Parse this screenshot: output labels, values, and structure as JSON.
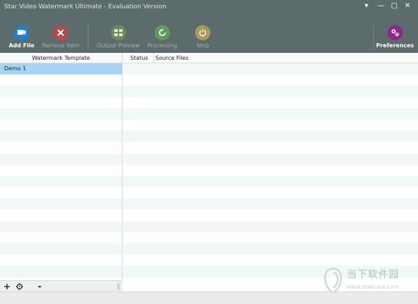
{
  "window": {
    "title": "Star Video Watermark Ultimate - Evaluation Version",
    "controls": [
      "▾",
      "—",
      "▢",
      "✕"
    ]
  },
  "toolbar": {
    "add_file": "Add File",
    "remove_item": "Remove Item",
    "output_preview": "Output Preview",
    "processing": "Processing",
    "stop": "Stop",
    "preferences": "Preferences"
  },
  "left_panel": {
    "header": "Watermark Template",
    "items": [
      "Demo 1"
    ]
  },
  "right_panel": {
    "columns": [
      "Status",
      "Source Files"
    ]
  },
  "watermark": {
    "text": "当下软件园",
    "url": "www.downxia.com"
  },
  "colors": {
    "chrome": "#5c6b6c",
    "selected_row": "#a7d3f5",
    "alt_row": "#f2f8f8"
  }
}
